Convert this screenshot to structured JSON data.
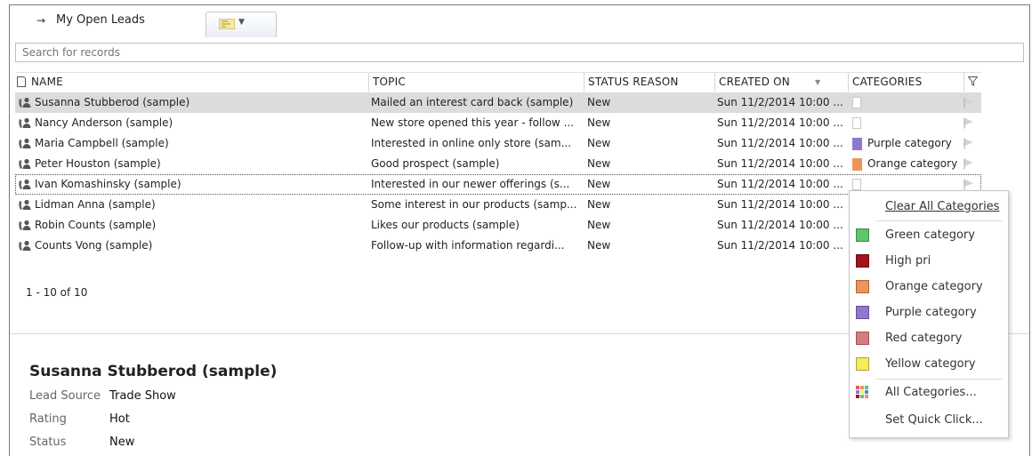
{
  "header": {
    "view_title": "My Open Leads",
    "pin_icon": "pin-icon",
    "view_selector_icon": "view-selector-icon"
  },
  "search": {
    "placeholder": "Search for records"
  },
  "grid": {
    "columns": [
      "NAME",
      "TOPIC",
      "STATUS REASON",
      "CREATED ON",
      "CATEGORIES"
    ],
    "rows": [
      {
        "name": "Susanna Stubberod (sample)",
        "topic": "Mailed an interest card back  (sample)",
        "status": "New",
        "created": "Sun 11/2/2014 10:00 ...",
        "category": ""
      },
      {
        "name": "Nancy Anderson (sample)",
        "topic": "New store opened this year - follow ...",
        "status": "New",
        "created": "Sun 11/2/2014 10:00 ...",
        "category": ""
      },
      {
        "name": "Maria Campbell (sample)",
        "topic": "Interested in online only store (sam...",
        "status": "New",
        "created": "Sun 11/2/2014 10:00 ...",
        "category": "Purple category",
        "color": "#8e78d0"
      },
      {
        "name": "Peter Houston (sample)",
        "topic": "Good prospect (sample)",
        "status": "New",
        "created": "Sun 11/2/2014 10:00 ...",
        "category": "Orange category",
        "color": "#f0935a"
      },
      {
        "name": "Ivan Komashinsky (sample)",
        "topic": "Interested in our newer offerings (s...",
        "status": "New",
        "created": "Sun 11/2/2014 10:00 ...",
        "category": ""
      },
      {
        "name": "Lidman Anna (sample)",
        "topic": "Some interest in our products (samp...",
        "status": "New",
        "created": "Sun 11/2/2014 10:00 ...",
        "category": ""
      },
      {
        "name": "Robin Counts (sample)",
        "topic": "Likes our products (sample)",
        "status": "New",
        "created": "Sun 11/2/2014 10:00 ...",
        "category": ""
      },
      {
        "name": "Counts Vong (sample)",
        "topic": "Follow-up with information regardi...",
        "status": "New",
        "created": "Sun 11/2/2014 10:00 ...",
        "category": ""
      }
    ]
  },
  "pager": {
    "text": "1 - 10 of 10"
  },
  "detail": {
    "title": "Susanna Stubberod (sample)",
    "fields": [
      {
        "label": "Lead Source",
        "value": "Trade Show"
      },
      {
        "label": "Rating",
        "value": "Hot"
      },
      {
        "label": "Status",
        "value": "New"
      }
    ]
  },
  "menu": {
    "clear_all": "Clear All Categories",
    "categories": [
      {
        "label": "Green category",
        "color": "#5fc46a"
      },
      {
        "label": "High pri",
        "color": "#a0141c"
      },
      {
        "label": "Orange category",
        "color": "#f0935a"
      },
      {
        "label": "Purple category",
        "color": "#8e78d0"
      },
      {
        "label": "Red category",
        "color": "#d97a80"
      },
      {
        "label": "Yellow category",
        "color": "#f5ec5c"
      }
    ],
    "all_categories": "All Categories...",
    "set_quick_click": "Set Quick Click..."
  }
}
